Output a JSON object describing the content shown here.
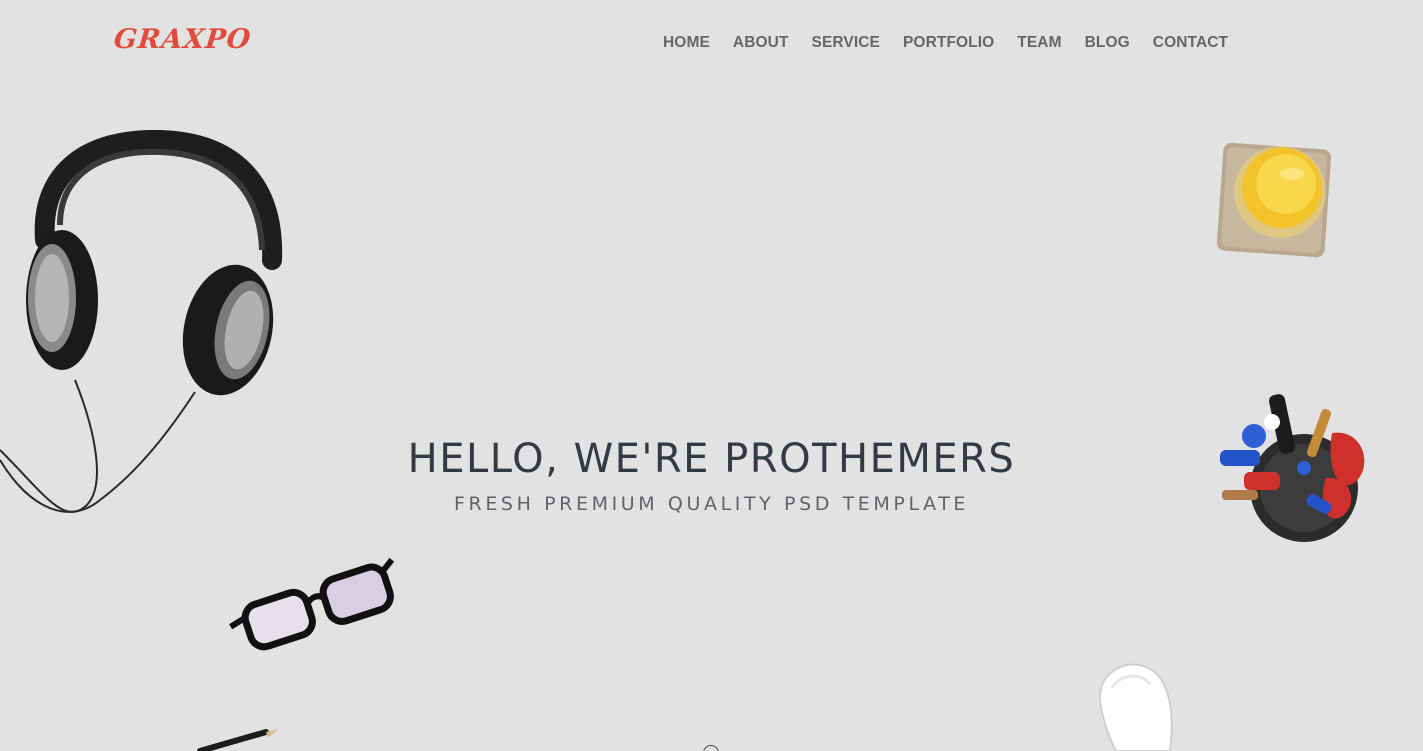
{
  "header": {
    "logo": "GRAXPO",
    "nav": [
      {
        "label": "HOME"
      },
      {
        "label": "ABOUT"
      },
      {
        "label": "SERVICE"
      },
      {
        "label": "PORTFOLIO"
      },
      {
        "label": "TEAM"
      },
      {
        "label": "BLOG"
      },
      {
        "label": "CONTACT"
      }
    ]
  },
  "hero": {
    "title": "HELLO, WE'RE PROTHEMERS",
    "subtitle": "FRESH PREMIUM QUALITY PSD TEMPLATE"
  },
  "colors": {
    "background": "#e2e2e2",
    "brand": "#e24b3c",
    "nav_text": "#666666",
    "title_text": "#333a44"
  },
  "decorations": [
    "headphones-image",
    "juice-glass-image",
    "pen-holder-image",
    "glasses-image",
    "mouse-image",
    "pencil-image"
  ]
}
